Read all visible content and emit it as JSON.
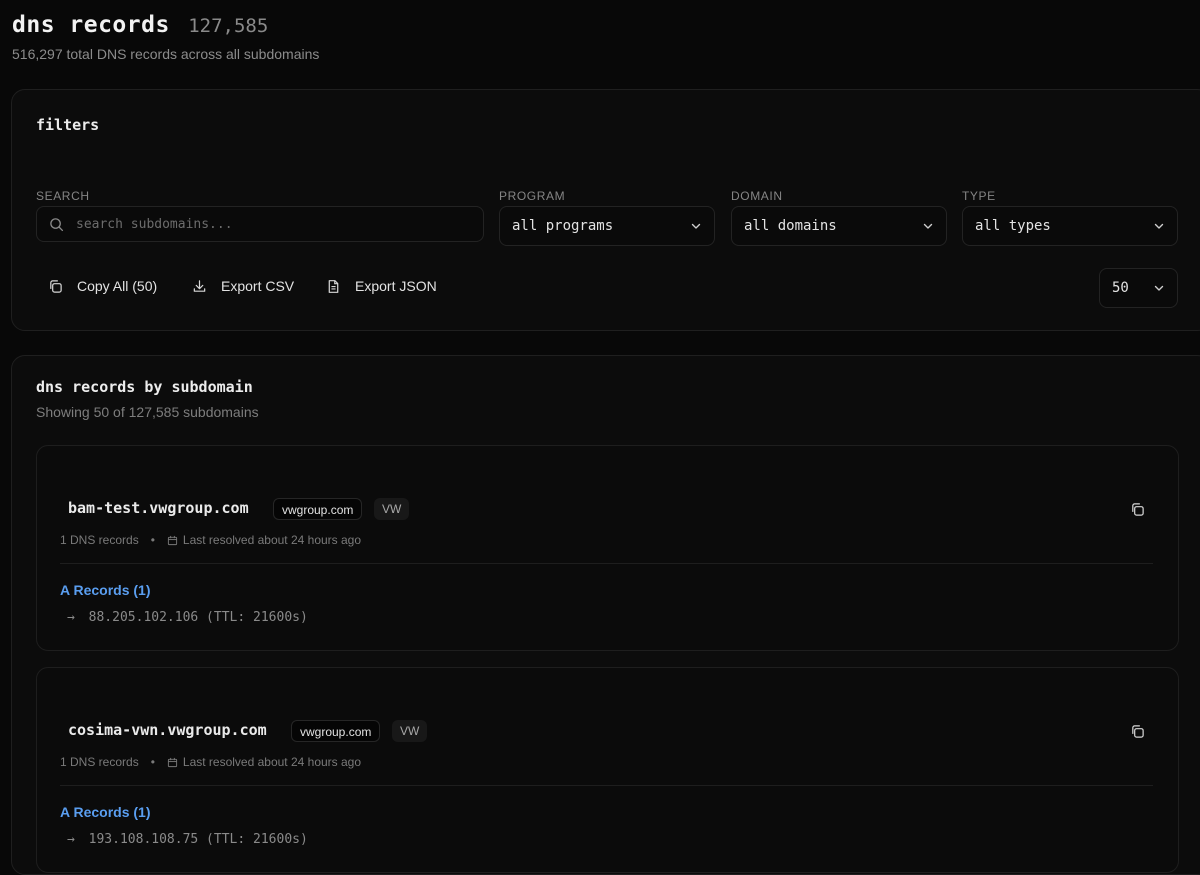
{
  "header": {
    "title": "dns records",
    "count": "127,585",
    "subtitle": "516,297 total DNS records across all subdomains"
  },
  "filters": {
    "title": "filters",
    "search_label": "SEARCH",
    "search_placeholder": "search subdomains...",
    "program_label": "PROGRAM",
    "program_value": "all programs",
    "domain_label": "DOMAIN",
    "domain_value": "all domains",
    "type_label": "TYPE",
    "type_value": "all types",
    "copy_all_label": "Copy All (50)",
    "export_csv_label": "Export CSV",
    "export_json_label": "Export JSON",
    "page_size": "50"
  },
  "records_section": {
    "title": "dns records by subdomain",
    "subtitle": "Showing 50 of 127,585 subdomains",
    "records": [
      {
        "name": "bam-test.vwgroup.com",
        "domain": "vwgroup.com",
        "program": "VW",
        "count_text": "1 DNS records",
        "resolved_text": "Last resolved about 24 hours ago",
        "type_label": "A Records (1)",
        "value": "88.205.102.106 (TTL: 21600s)"
      },
      {
        "name": "cosima-vwn.vwgroup.com",
        "domain": "vwgroup.com",
        "program": "VW",
        "count_text": "1 DNS records",
        "resolved_text": "Last resolved about 24 hours ago",
        "type_label": "A Records (1)",
        "value": "193.108.108.75 (TTL: 21600s)"
      }
    ]
  },
  "arrow_glyph": "→"
}
